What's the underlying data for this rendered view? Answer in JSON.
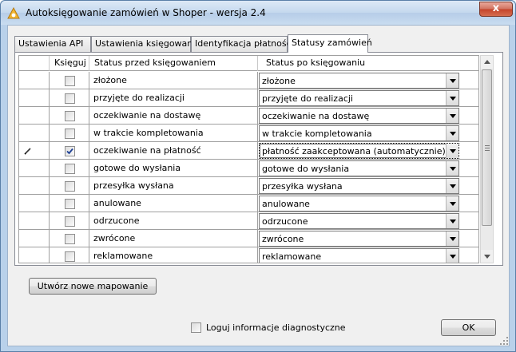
{
  "window": {
    "title": "Autoksięgowanie zamówień w Shoper - wersja 2.4",
    "close_glyph": "x"
  },
  "tabs": [
    {
      "label": "Ustawienia API"
    },
    {
      "label": "Ustawienia księgowania"
    },
    {
      "label": "Identyfikacja płatności"
    },
    {
      "label": "Statusy zamówień",
      "active": true
    }
  ],
  "grid": {
    "columns": {
      "post": "Księguj",
      "status_before": "Status przed księgowaniem",
      "status_after": "Status po księgowaniu"
    },
    "rows": [
      {
        "checked": false,
        "before": "złożone",
        "after": "złożone"
      },
      {
        "checked": false,
        "before": "przyjęte do realizacji",
        "after": "przyjęte do realizacji"
      },
      {
        "checked": false,
        "before": "oczekiwanie na dostawę",
        "after": "oczekiwanie na dostawę"
      },
      {
        "checked": false,
        "before": "w trakcie kompletowania",
        "after": "w trakcie kompletowania"
      },
      {
        "checked": true,
        "editing": true,
        "before": "oczekiwanie na płatność",
        "after": "płatność zaakceptowana (automatycznie)"
      },
      {
        "checked": false,
        "before": "gotowe do wysłania",
        "after": "gotowe do wysłania"
      },
      {
        "checked": false,
        "before": "przesyłka wysłana",
        "after": "przesyłka wysłana"
      },
      {
        "checked": false,
        "before": "anulowane",
        "after": "anulowane"
      },
      {
        "checked": false,
        "before": "odrzucone",
        "after": "odrzucone"
      },
      {
        "checked": false,
        "before": "zwrócone",
        "after": "zwrócone"
      },
      {
        "checked": false,
        "before": "reklamowane",
        "after": "reklamowane"
      }
    ]
  },
  "buttons": {
    "new_mapping": "Utwórz nowe mapowanie",
    "ok": "OK"
  },
  "diagnostics": {
    "label": "Loguj informacje diagnostyczne",
    "checked": false
  },
  "colors": {
    "frame": "#b9d1ea",
    "check_mark": "#1c3f94"
  }
}
